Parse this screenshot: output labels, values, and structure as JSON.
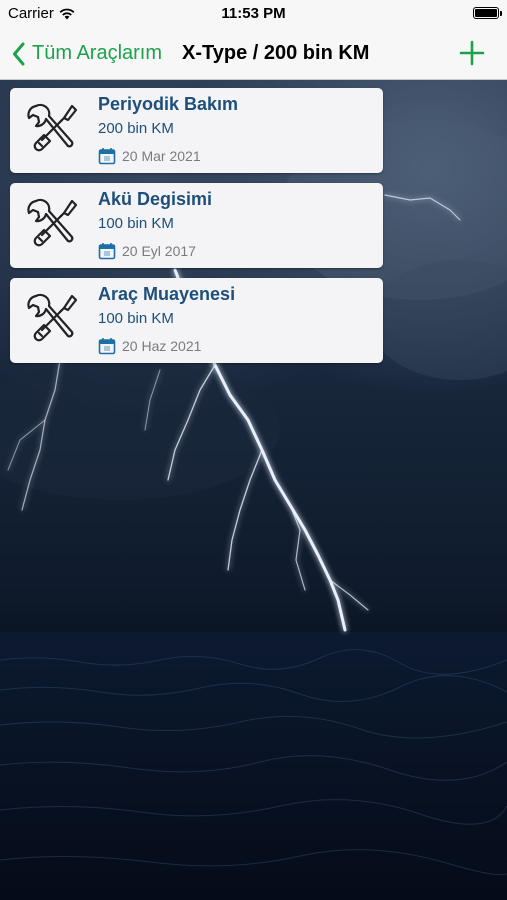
{
  "status_bar": {
    "carrier": "Carrier",
    "time": "11:53 PM",
    "wifi_icon": "wifi-icon",
    "battery_icon": "battery-icon"
  },
  "nav": {
    "back_label": "Tüm Araçlarım",
    "back_icon": "chevron-left-icon",
    "title": "X-Type / 200 bin KM",
    "add_icon": "plus-icon",
    "accent_color": "#1aa34a"
  },
  "maintenance_items": [
    {
      "title": "Periyodik Bakım",
      "km": "200 bin KM",
      "date": "20 Mar 2021",
      "icon": "wrench-screwdriver-icon",
      "date_icon": "calendar-icon"
    },
    {
      "title": "Akü Degisimi",
      "km": "100 bin KM",
      "date": "20 Eyl 2017",
      "icon": "wrench-screwdriver-icon",
      "date_icon": "calendar-icon"
    },
    {
      "title": "Araç Muayenesi",
      "km": "100 bin KM",
      "date": "20 Haz 2021",
      "icon": "wrench-screwdriver-icon",
      "date_icon": "calendar-icon"
    }
  ],
  "colors": {
    "title_text": "#1d4f7a",
    "date_text": "#7a7a80",
    "card_background": "#f4f4f6"
  }
}
